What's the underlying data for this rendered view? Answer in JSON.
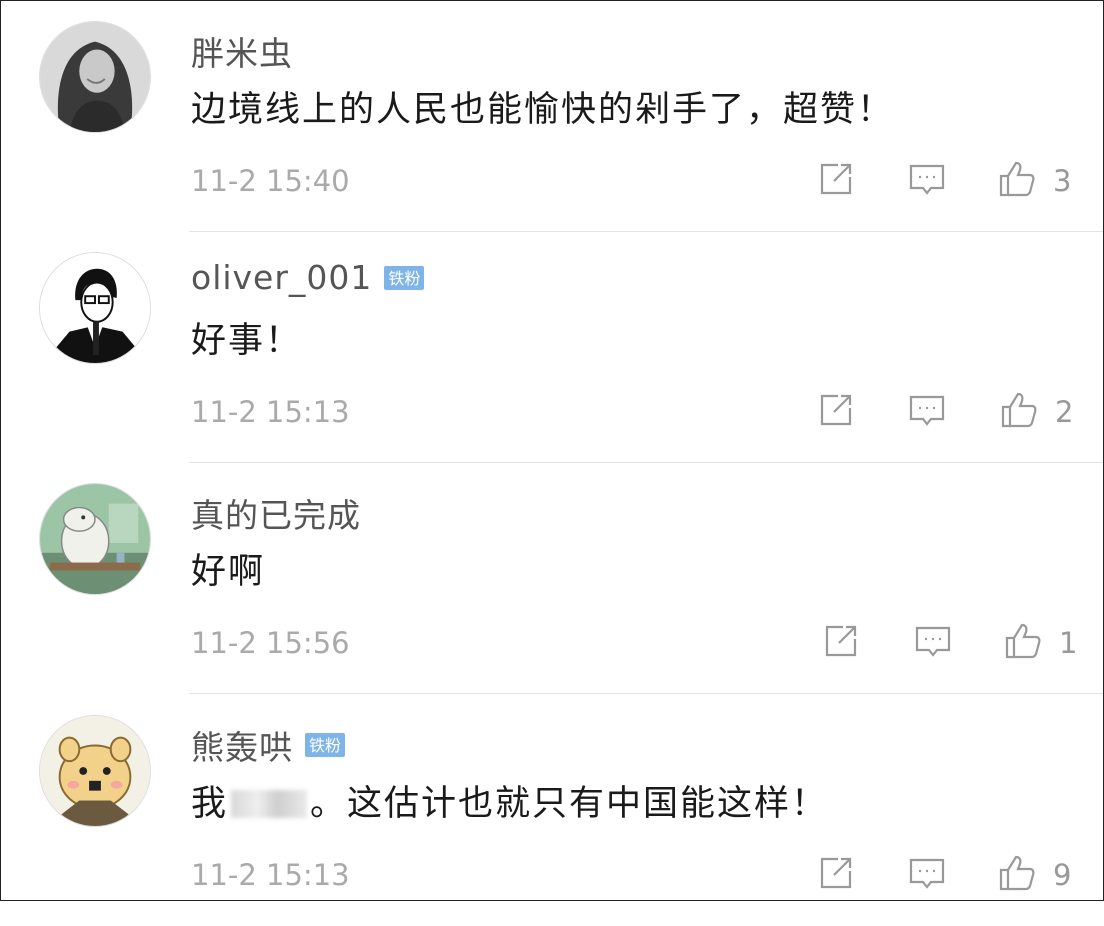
{
  "comments": [
    {
      "username": "胖米虫",
      "badge": "",
      "content": "边境线上的人民也能愉快的剁手了，超赞！",
      "content_before": "",
      "content_after": "",
      "time": "11-2 15:40",
      "likes": "3",
      "avatar_icon": "woman-portrait-avatar"
    },
    {
      "username": "oliver_001",
      "badge": "铁粉",
      "content": "好事！",
      "content_before": "",
      "content_after": "",
      "time": "11-2 15:13",
      "likes": "2",
      "avatar_icon": "man-sketch-avatar"
    },
    {
      "username": "真的已完成",
      "badge": "",
      "content": "好啊",
      "content_before": "",
      "content_after": "",
      "time": "11-2 15:56",
      "likes": "1",
      "avatar_icon": "moomin-avatar"
    },
    {
      "username": "熊轰哄",
      "badge": "铁粉",
      "content": "",
      "content_before": "我",
      "content_after": "。这估计也就只有中国能这样！",
      "time": "11-2 15:13",
      "likes": "9",
      "avatar_icon": "hamster-avatar"
    }
  ],
  "colors": {
    "badge_bg": "#7fb4e8",
    "username": "#555555",
    "timestamp": "#aaaaaa",
    "icon_stroke": "#999999"
  }
}
